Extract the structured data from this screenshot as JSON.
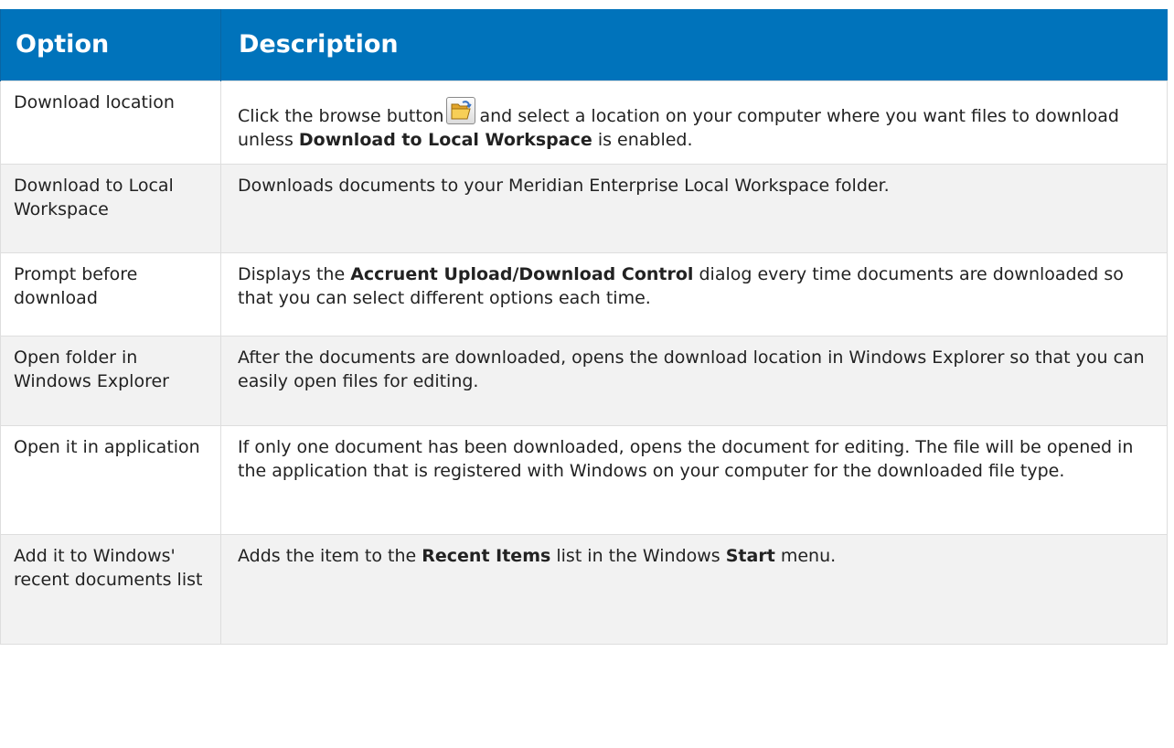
{
  "table": {
    "headers": [
      "Option",
      "Description"
    ],
    "rows": [
      {
        "option": "Download location",
        "desc_parts": [
          "Click the browse button",
          "and select a location on your computer where you want files to download unless",
          "Download to Local Workspace",
          "is enabled."
        ],
        "icon": "folder-open-icon"
      },
      {
        "option": "Download to Local Workspace",
        "desc_parts": [
          "Downloads documents to your Meridian Enterprise Local Workspace folder."
        ]
      },
      {
        "option": "Prompt before download",
        "desc_parts": [
          "Displays the",
          "Accruent Upload/Download Control",
          "dialog every time documents are downloaded so that you can select different options each time."
        ]
      },
      {
        "option": "Open folder in Windows Explorer",
        "desc_parts": [
          "After the documents are downloaded, opens the download location in Windows Explorer so that you can easily open files for editing."
        ]
      },
      {
        "option": "Open it in application",
        "desc_parts": [
          "If only one document has been downloaded, opens the document for editing. The file will be opened in the application that is registered with Windows on your computer for the downloaded file type."
        ]
      },
      {
        "option": "Add it to Windows' recent documents list",
        "desc_parts": [
          "Adds the item to the",
          "Recent Items",
          "list in the Windows",
          "Start",
          "menu."
        ]
      }
    ]
  },
  "colors": {
    "header_bg": "#0073bb",
    "header_text": "#ffffff",
    "row_alt_bg": "#f2f2f2",
    "border": "#dedede"
  }
}
